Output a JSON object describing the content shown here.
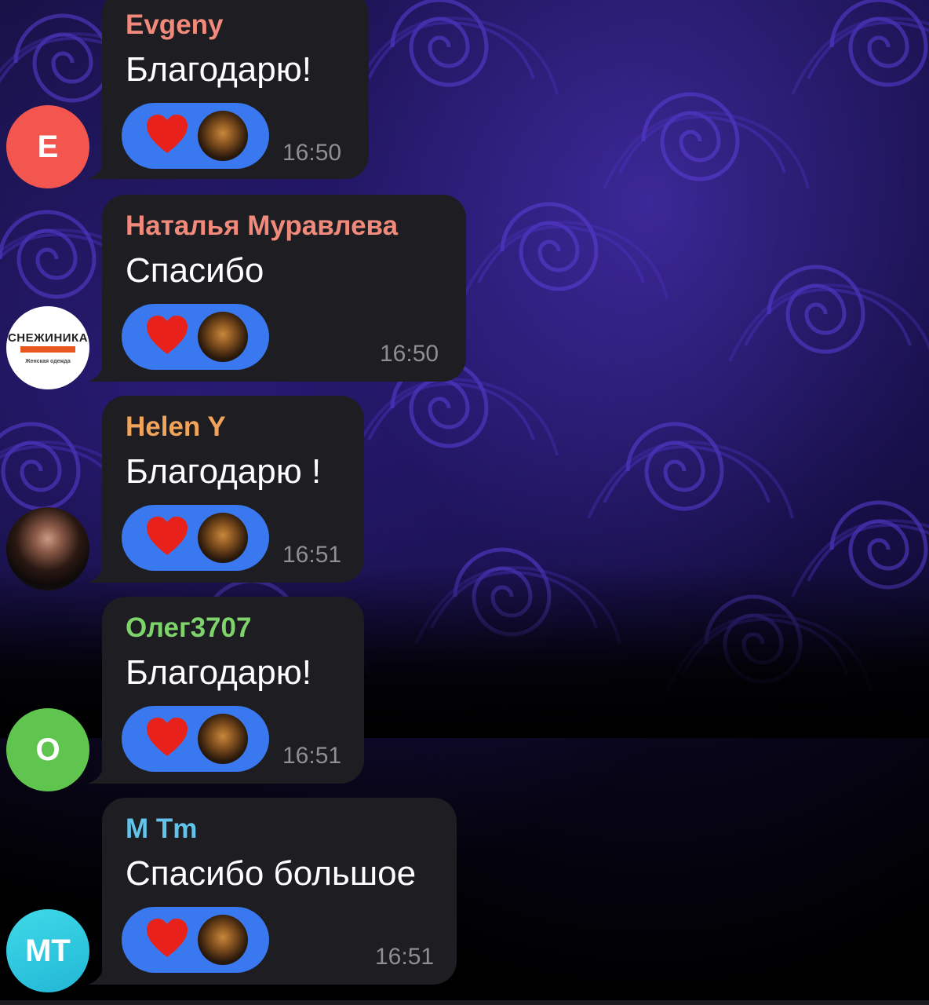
{
  "messages": [
    {
      "sender": "Evgeny",
      "sender_color": "#f28a7c",
      "text": "Благодарю!",
      "time": "16:50",
      "avatar": {
        "initials": "E",
        "color": "#f2564f"
      }
    },
    {
      "sender": "Наталья Муравлева",
      "sender_color": "#f28a7c",
      "text": "Спасибо",
      "time": "16:50",
      "avatar": {
        "logo_text": "СНЕЖИНИКА",
        "logo_subtext": "Женская одежда"
      }
    },
    {
      "sender": "Helen Y",
      "sender_color": "#f2a55a",
      "text": "Благодарю !",
      "time": "16:51",
      "avatar": {
        "type": "photo"
      }
    },
    {
      "sender": "Олег3707",
      "sender_color": "#7ed36a",
      "text": "Благодарю!",
      "time": "16:51",
      "avatar": {
        "initials": "О",
        "color": "#5fc54f"
      }
    },
    {
      "sender": "M Tm",
      "sender_color": "#62c4ea",
      "text": "Спасибо большое",
      "time": "16:51",
      "avatar": {
        "initials": "MT",
        "color": "#2ec7de"
      }
    }
  ],
  "reaction": {
    "emoji": "heart-icon",
    "color": "#3a78f0",
    "heart_color": "#e8221b"
  },
  "colors": {
    "bubble": "#1d1d22",
    "time": "#8e8e93"
  }
}
